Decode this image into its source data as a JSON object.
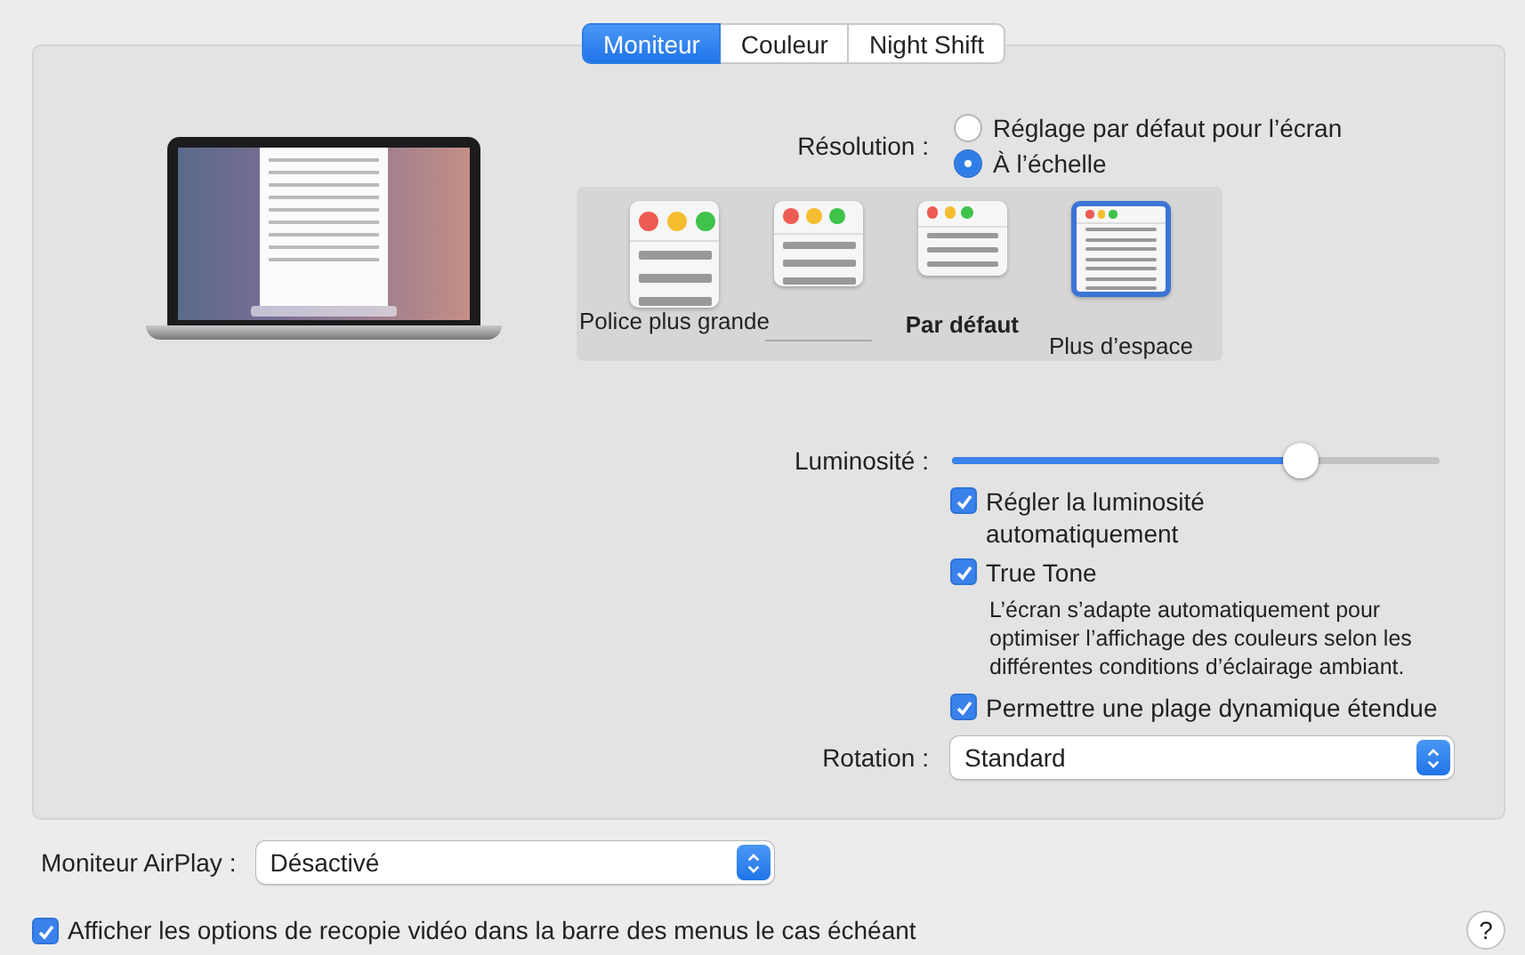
{
  "tabs": [
    {
      "label": "Moniteur",
      "selected": true
    },
    {
      "label": "Couleur",
      "selected": false
    },
    {
      "label": "Night Shift",
      "selected": false
    }
  ],
  "resolution": {
    "label": "Résolution :",
    "options": [
      {
        "label": "Réglage par défaut pour l’écran",
        "selected": false
      },
      {
        "label": "À l’échelle",
        "selected": true
      }
    ]
  },
  "scale_options": [
    {
      "label": "Police plus grande",
      "selected": false,
      "default": false
    },
    {
      "selected": false,
      "default": false
    },
    {
      "label": "Par défaut",
      "selected": false,
      "default": true
    },
    {
      "label": "Plus d’espace",
      "selected": true,
      "default": false
    }
  ],
  "brightness": {
    "label": "Luminosité :",
    "level": 0.69
  },
  "checkboxes": [
    {
      "label": "Régler la luminosité automatiquement",
      "checked": true
    },
    {
      "label": "True Tone",
      "checked": true,
      "description": "L’écran s’adapte automatiquement pour optimiser l’affichage des couleurs selon les différentes conditions d’éclairage ambiant."
    },
    {
      "label": "Permettre une plage dynamique étendue",
      "checked": true
    }
  ],
  "rotation": {
    "label": "Rotation :",
    "value": "Standard"
  },
  "airplay": {
    "label": "Moniteur AirPlay :",
    "value": "Désactivé"
  },
  "mirroring_option": {
    "label": "Afficher les options de recopie vidéo dans la barre des menus le cas échéant",
    "checked": true
  },
  "help": "?"
}
